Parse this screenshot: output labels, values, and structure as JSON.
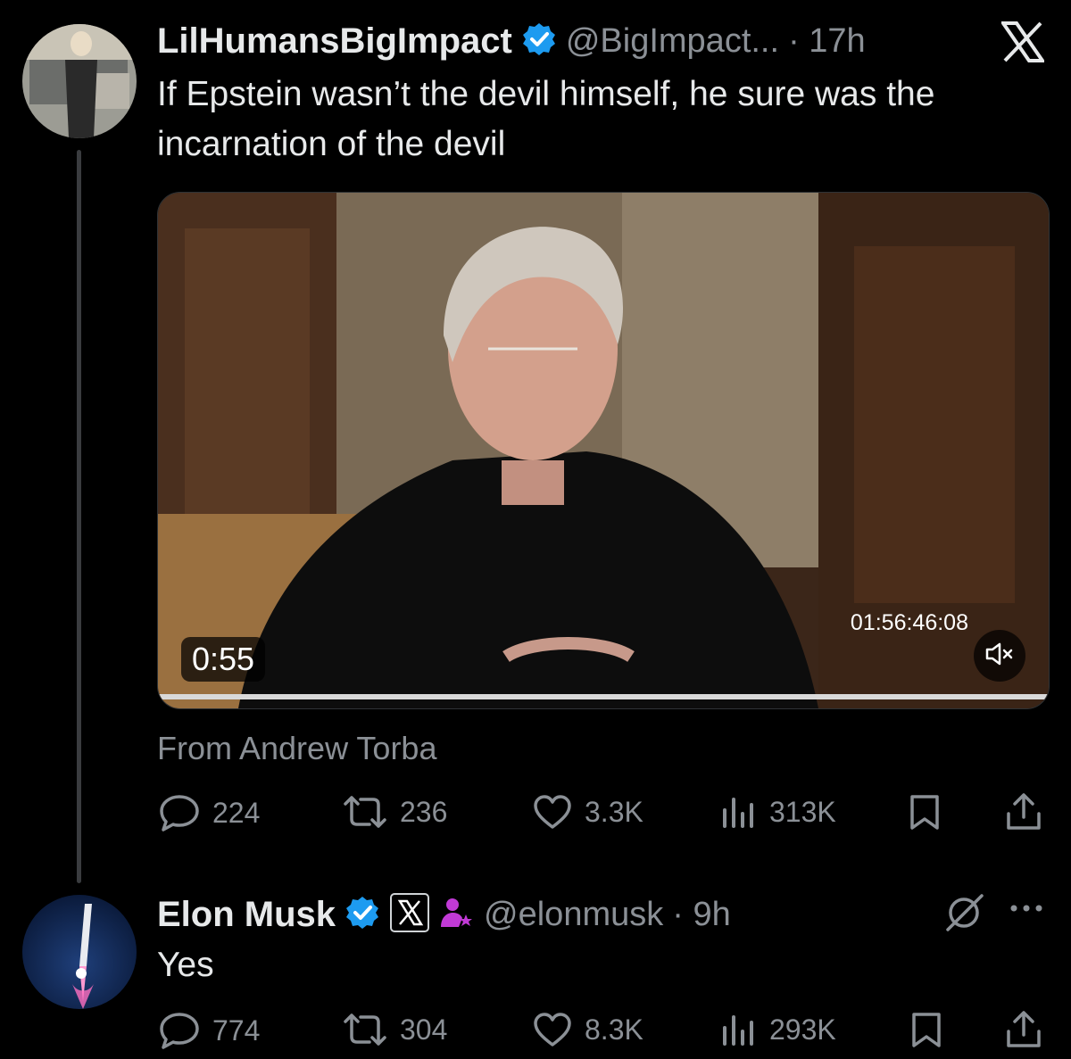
{
  "tweet1": {
    "display_name": "LilHumansBigImpact",
    "handle": "@BigImpact...",
    "time": "· 17h",
    "text": "If Epstein wasn’t the devil himself, he sure was the incarnation of the devil",
    "media": {
      "duration": "0:55",
      "timecode": "01:56:46:08"
    },
    "attribution": "From Andrew Torba",
    "stats": {
      "replies": "224",
      "reposts": "236",
      "likes": "3.3K",
      "views": "313K"
    }
  },
  "tweet2": {
    "display_name": "Elon Musk",
    "handle": "@elonmusk",
    "time": "· 9h",
    "text": "Yes",
    "stats": {
      "replies": "774",
      "reposts": "304",
      "likes": "8.3K",
      "views": "293K"
    }
  },
  "icons": [
    "x-logo-icon",
    "verified-badge-icon",
    "affiliate-x-badge-icon",
    "subscriber-icon",
    "grok-icon",
    "more-icon",
    "reply-icon",
    "repost-icon",
    "like-icon",
    "views-icon",
    "bookmark-icon",
    "share-icon",
    "mute-icon"
  ],
  "colors": {
    "background": "#000000",
    "text": "#e7e9ea",
    "secondary": "#8b9096",
    "verified": "#1d9bf0",
    "purple": "#c13ad6"
  }
}
